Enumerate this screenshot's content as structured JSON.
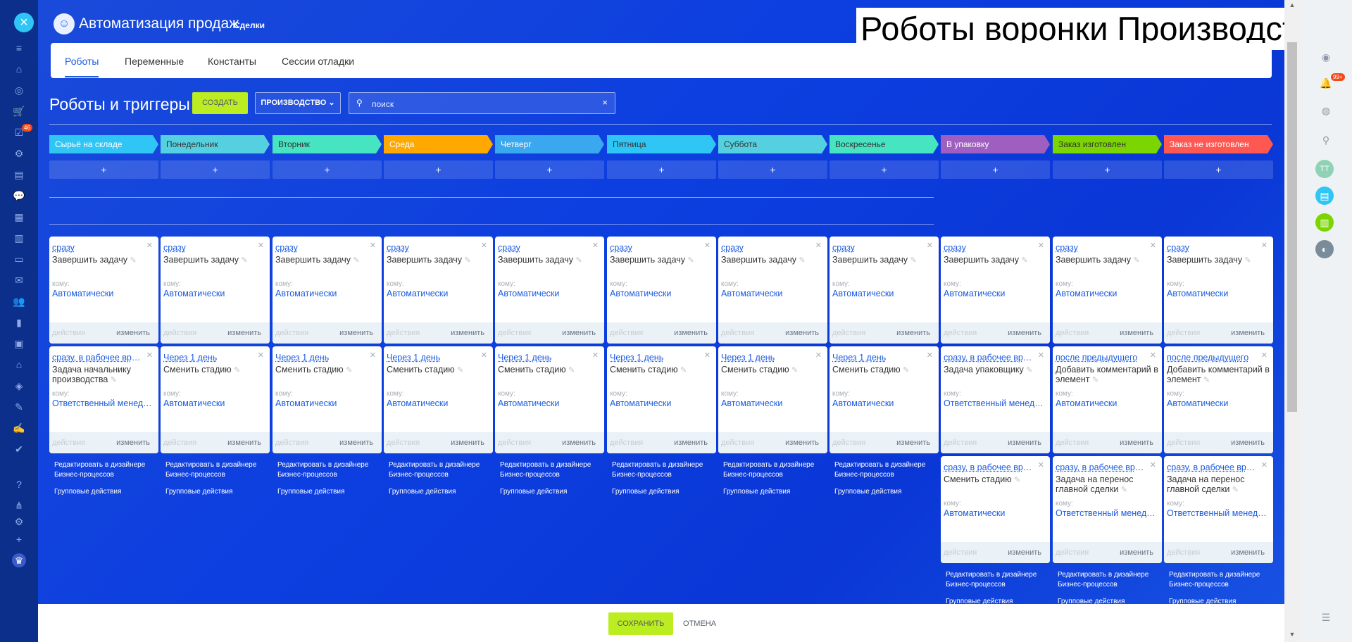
{
  "app": {
    "title": "Автоматизация продаж",
    "subtitle": "Сделки",
    "overlay_title": "Роботы воронки Производство",
    "notification_badge": "99+",
    "left_badge": "46",
    "avatar_initials": "TT"
  },
  "tabs": [
    {
      "label": "Роботы",
      "active": true
    },
    {
      "label": "Переменные",
      "active": false
    },
    {
      "label": "Константы",
      "active": false
    },
    {
      "label": "Сессии отладки",
      "active": false
    }
  ],
  "toolbar": {
    "page_title": "Роботы и триггеры",
    "create_label": "СОЗДАТЬ",
    "funnel_label": "ПРОИЗВОДСТВО",
    "search_placeholder": "поиск",
    "add_label": "+"
  },
  "common": {
    "to_label": "кому:",
    "actions_label": "действия",
    "change_label": "изменить",
    "edit_designer": "Редактировать в дизайнере Бизнес-процессов",
    "group_actions": "Групповые действия"
  },
  "colors": {
    "accent": "#1a5be0",
    "create_button": "#bbed21",
    "left_nav": "#0c2f8c"
  },
  "stages": [
    {
      "name": "Сырьё на складе",
      "color": "#2fc6f6",
      "text": "#ffffff",
      "robots": [
        {
          "when": "сразу",
          "name": "Завершить задачу",
          "responsible": "Автоматически"
        },
        {
          "when": "сразу, в рабочее время",
          "name": "Задача начальнику производства",
          "responsible": "Ответственный менеджер"
        }
      ]
    },
    {
      "name": "Понедельник",
      "color": "#55d0e0",
      "text": "#333333",
      "robots": [
        {
          "when": "сразу",
          "name": "Завершить задачу",
          "responsible": "Автоматически"
        },
        {
          "when": "Через 1 день",
          "name": "Сменить стадию",
          "responsible": "Автоматически"
        }
      ]
    },
    {
      "name": "Вторник",
      "color": "#47e4c2",
      "text": "#333333",
      "robots": [
        {
          "when": "сразу",
          "name": "Завершить задачу",
          "responsible": "Автоматически"
        },
        {
          "when": "Через 1 день",
          "name": "Сменить стадию",
          "responsible": "Автоматически"
        }
      ]
    },
    {
      "name": "Среда",
      "color": "#ffa900",
      "text": "#ffffff",
      "robots": [
        {
          "when": "сразу",
          "name": "Завершить задачу",
          "responsible": "Автоматически"
        },
        {
          "when": "Через 1 день",
          "name": "Сменить стадию",
          "responsible": "Автоматически"
        }
      ]
    },
    {
      "name": "Четверг",
      "color": "#39a8ef",
      "text": "#ffffff",
      "robots": [
        {
          "when": "сразу",
          "name": "Завершить задачу",
          "responsible": "Автоматически"
        },
        {
          "when": "Через 1 день",
          "name": "Сменить стадию",
          "responsible": "Автоматически"
        }
      ]
    },
    {
      "name": "Пятница",
      "color": "#2fc6f6",
      "text": "#333333",
      "robots": [
        {
          "when": "сразу",
          "name": "Завершить задачу",
          "responsible": "Автоматически"
        },
        {
          "when": "Через 1 день",
          "name": "Сменить стадию",
          "responsible": "Автоматически"
        }
      ]
    },
    {
      "name": "Суббота",
      "color": "#55d0e0",
      "text": "#333333",
      "robots": [
        {
          "when": "сразу",
          "name": "Завершить задачу",
          "responsible": "Автоматически"
        },
        {
          "when": "Через 1 день",
          "name": "Сменить стадию",
          "responsible": "Автоматически"
        }
      ]
    },
    {
      "name": "Воскресенье",
      "color": "#47e4c2",
      "text": "#333333",
      "robots": [
        {
          "when": "сразу",
          "name": "Завершить задачу",
          "responsible": "Автоматически"
        },
        {
          "when": "Через 1 день",
          "name": "Сменить стадию",
          "responsible": "Автоматически"
        }
      ]
    },
    {
      "name": "В упаковку",
      "color": "#9f5fc0",
      "text": "#ffffff",
      "robots": [
        {
          "when": "сразу",
          "name": "Завершить задачу",
          "responsible": "Автоматически"
        },
        {
          "when": "сразу, в рабочее время",
          "name": "Задача упаковщику",
          "responsible": "Ответственный менеджер"
        },
        {
          "when": "сразу, в рабочее время",
          "name": "Сменить стадию",
          "responsible": "Автоматически"
        }
      ]
    },
    {
      "name": "Заказ изготовлен",
      "color": "#7bd500",
      "text": "#333333",
      "robots": [
        {
          "when": "сразу",
          "name": "Завершить задачу",
          "responsible": "Автоматически"
        },
        {
          "when": "после предыдущего",
          "name": "Добавить комментарий в элемент",
          "responsible": "Автоматически"
        },
        {
          "when": "сразу, в рабочее время",
          "name": "Задача на перенос главной сделки",
          "responsible": "Ответственный менеджер"
        }
      ]
    },
    {
      "name": "Заказ не изготовлен",
      "color": "#ff5752",
      "text": "#ffffff",
      "robots": [
        {
          "when": "сразу",
          "name": "Завершить задачу",
          "responsible": "Автоматически"
        },
        {
          "when": "после предыдущего",
          "name": "Добавить комментарий в элемент",
          "responsible": "Автоматически"
        },
        {
          "when": "сразу, в рабочее время",
          "name": "Задача на перенос главной сделки",
          "responsible": "Ответственный менеджер"
        }
      ]
    }
  ],
  "footer": {
    "save_label": "СОХРАНИТЬ",
    "cancel_label": "ОТМЕНА"
  }
}
